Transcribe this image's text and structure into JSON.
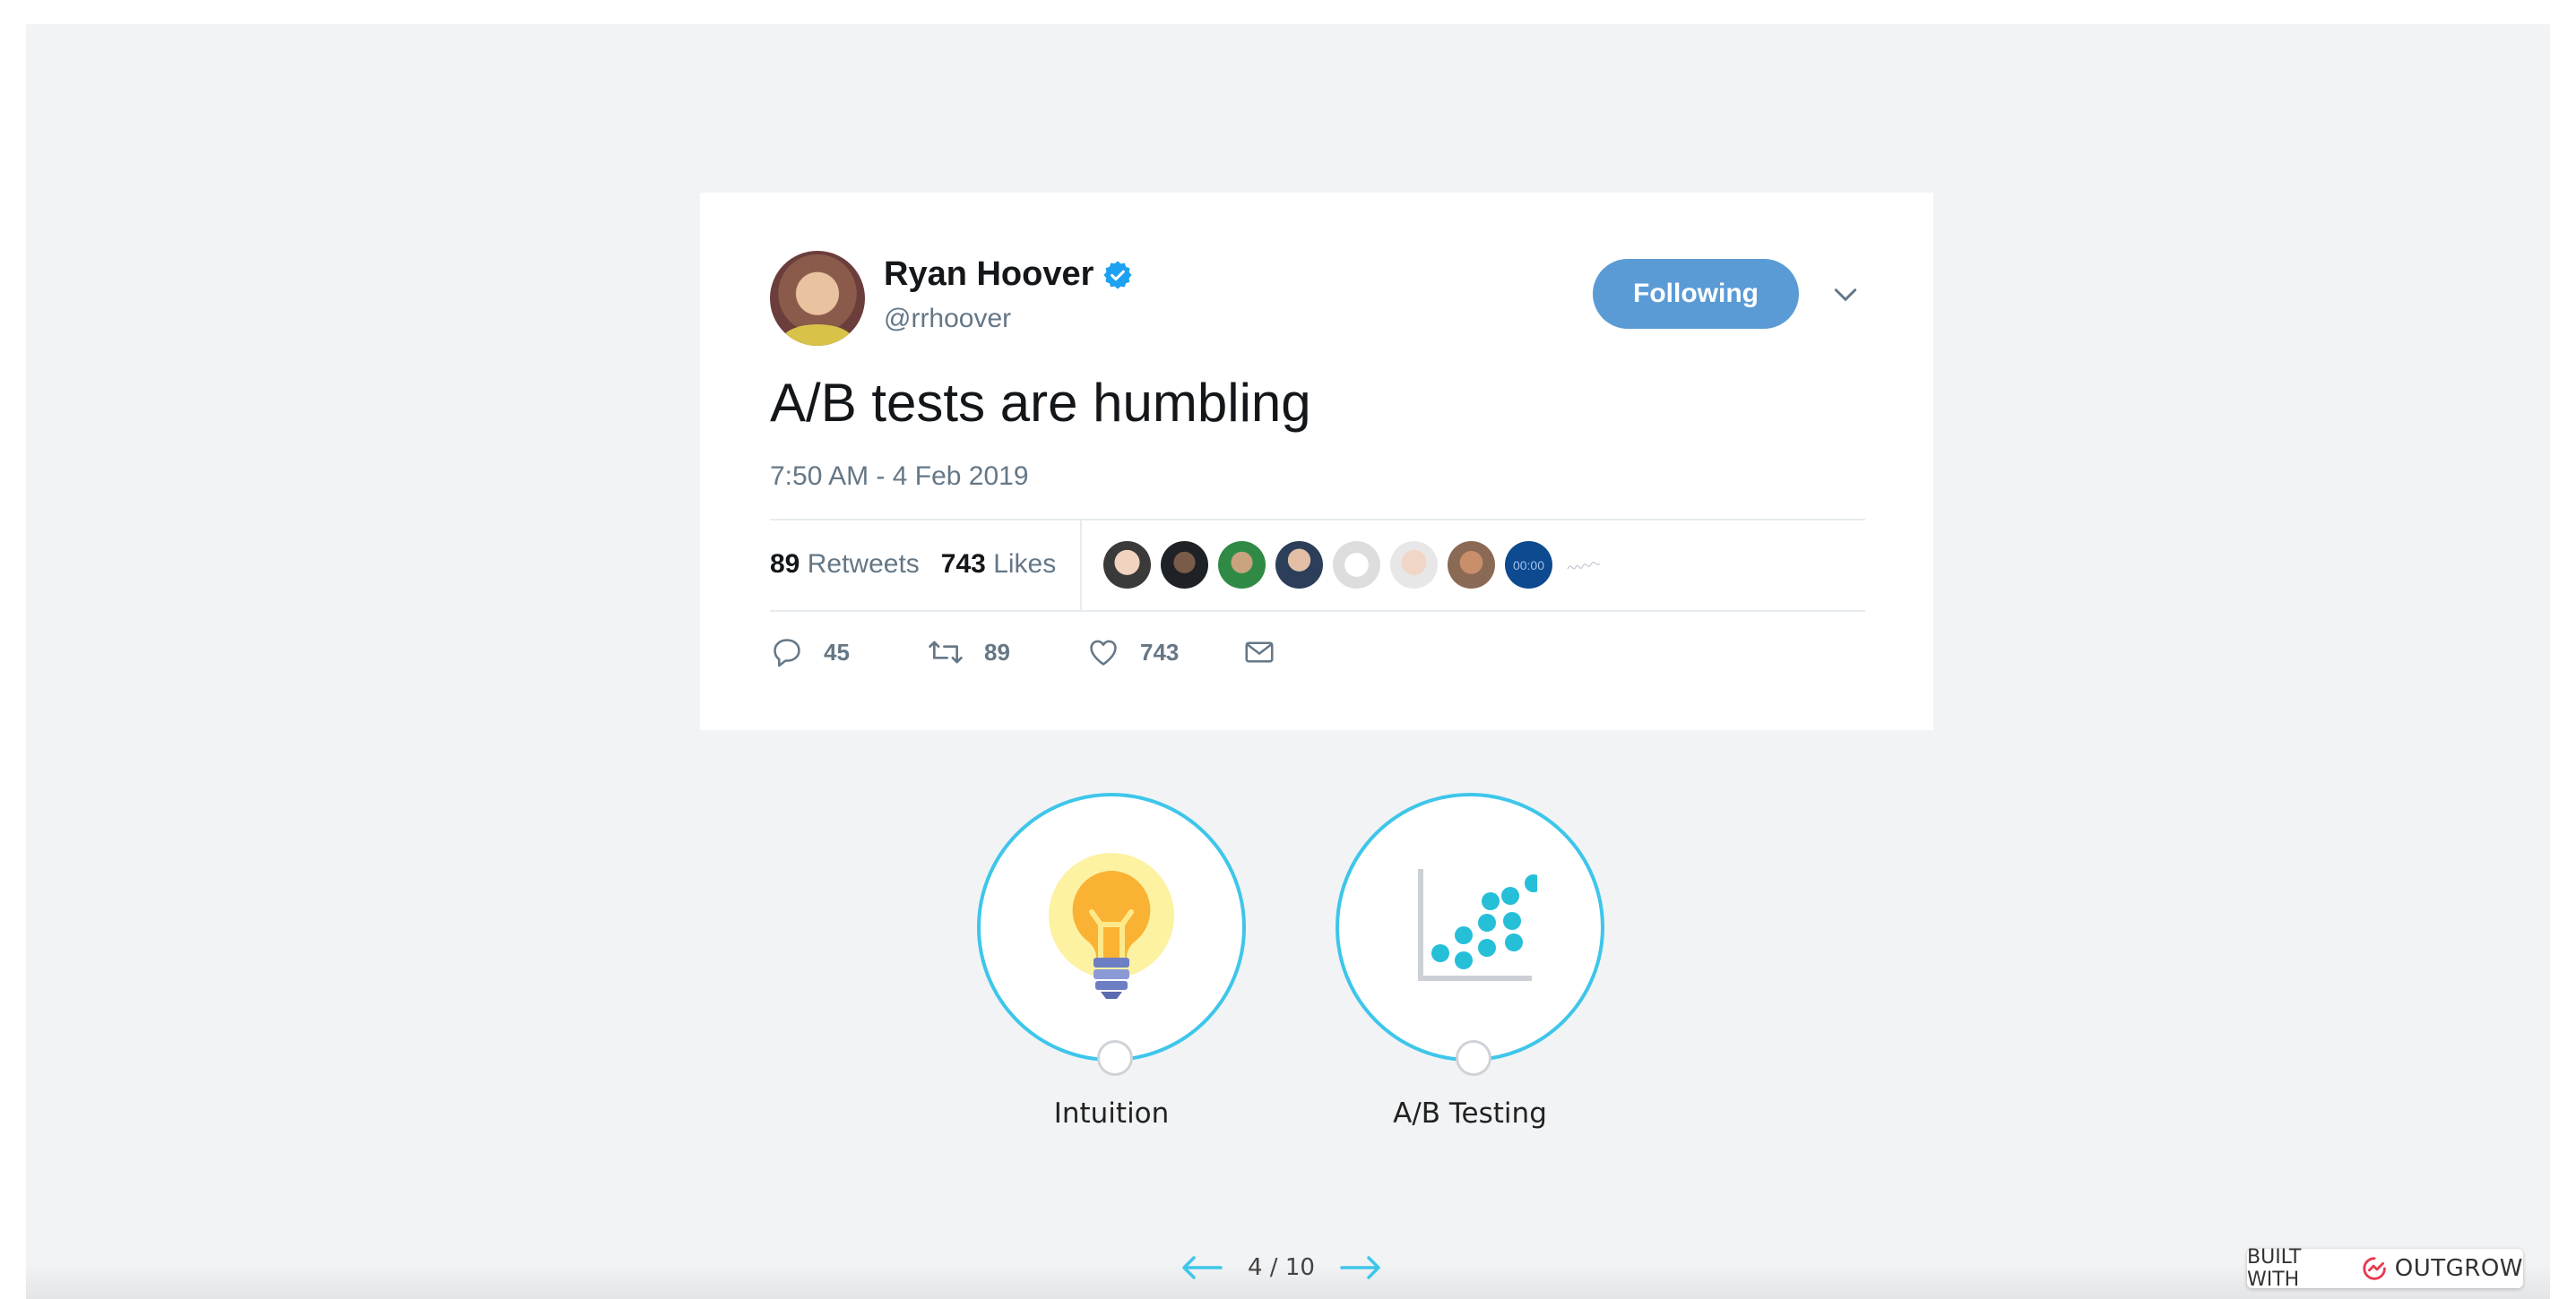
{
  "tweet": {
    "author_name": "Ryan Hoover",
    "handle": "@rrhoover",
    "follow_label": "Following",
    "text": "A/B tests are humbling",
    "timestamp": "7:50 AM - 4 Feb 2019",
    "retweets_count": "89",
    "retweets_label": "Retweets",
    "likes_count": "743",
    "likes_label": "Likes",
    "reply_count": "45",
    "retweet_action_count": "89",
    "like_action_count": "743",
    "liker_badge_text": "00:00",
    "colors": {
      "follow_button": "#5b9bd5",
      "verified": "#1da1f2",
      "muted": "#657786"
    }
  },
  "choices": [
    {
      "label": "Intuition",
      "icon": "lightbulb-icon"
    },
    {
      "label": "A/B Testing",
      "icon": "scatter-chart-icon"
    }
  ],
  "footer": {
    "pager": "4 / 10",
    "built_with": "BUILT WITH",
    "brand": "OUTGROW"
  },
  "colors": {
    "accent": "#3ec6ea",
    "stage_bg": "#f2f3f5"
  }
}
